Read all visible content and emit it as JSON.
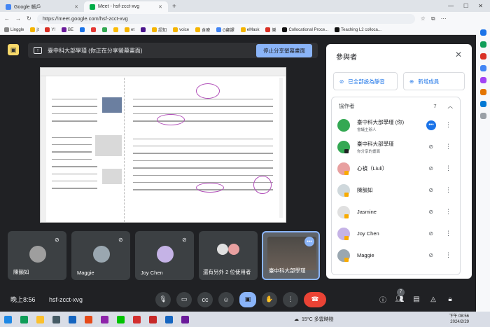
{
  "browser": {
    "tabs": [
      {
        "title": "Google 帳戶",
        "active": false
      },
      {
        "title": "Meet - hsf-zcct-xvg",
        "active": true
      }
    ],
    "url": "https://meet.google.com/hsf-zcct-xvg",
    "bookmarks": [
      "Linggle",
      "jt",
      "Y!",
      "BE",
      "",
      "",
      "",
      "",
      "et",
      "",
      "認知",
      "voice",
      "食療",
      "G翻譯",
      "eMask",
      "樂",
      "Collocational Proce...",
      "Teaching L2 colloca..."
    ]
  },
  "share": {
    "banner_text": "臺中科大部學瑾 (你正在分享螢幕畫面)",
    "stop_label": "停止分享螢幕畫面"
  },
  "tiles": [
    {
      "name": "陳韻如"
    },
    {
      "name": "Maggie"
    },
    {
      "name": "Joy Chen"
    },
    {
      "name": "還有另外 2 位使用者"
    },
    {
      "name": "臺中科大部學瑾"
    }
  ],
  "bottom": {
    "time": "晚上8:56",
    "meeting_code": "hsf-zcct-xvg",
    "people_count": "7"
  },
  "panel": {
    "title": "參與者",
    "mute_all_label": "已全部設為靜音",
    "add_label": "新增成員",
    "section_label": "協作者",
    "section_count": "7",
    "people": [
      {
        "name": "臺中科大部學瑾 (你)",
        "sub": "會議主辦人",
        "color": "#34a853"
      },
      {
        "name": "臺中科大部學瑾",
        "sub": "你分享的畫面",
        "color": "#34a853"
      },
      {
        "name": "心禎（Liuli）",
        "sub": "",
        "color": "#e8a0a0"
      },
      {
        "name": "陳韻如",
        "sub": "",
        "color": "#cfd8dc"
      },
      {
        "name": "Jasmine",
        "sub": "",
        "color": "#e0e0e0"
      },
      {
        "name": "Joy Chen",
        "sub": "",
        "color": "#c5b3e6"
      },
      {
        "name": "Maggie",
        "sub": "",
        "color": "#9aa7b0"
      }
    ]
  },
  "taskbar": {
    "weather": "15°C 多雲時陰",
    "clock_time": "下午 08:56",
    "clock_date": "2024/2/29"
  }
}
